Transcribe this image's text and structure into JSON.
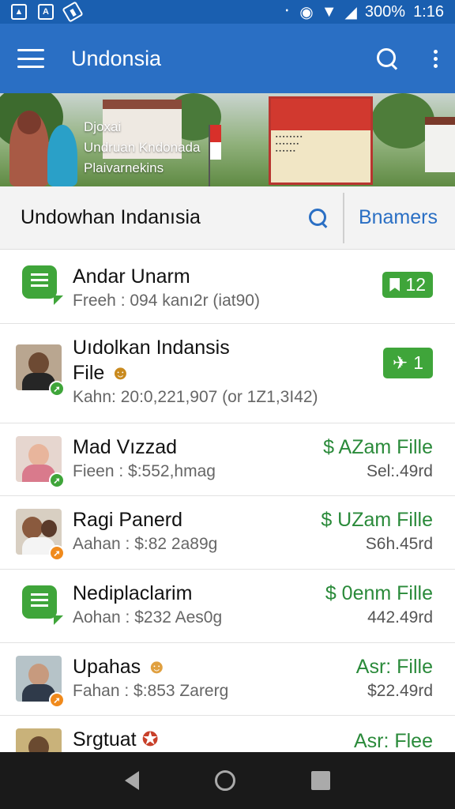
{
  "status_bar": {
    "battery_text": "300%",
    "time": "1:16"
  },
  "app_bar": {
    "title": "Undonsia"
  },
  "banner": {
    "lines": [
      "Djoxai",
      "Undruan Kndonada",
      "Plaivarnekins"
    ]
  },
  "search_row": {
    "label": "Undowhan Indanısia",
    "button": "Bnamers"
  },
  "rows": [
    {
      "title": "Andar Unarm",
      "subtitle": "Freeh : 094 kanı2r (iat90)",
      "badge": "12",
      "icon": "chat-icon"
    },
    {
      "title_line1": "Uıdolkan Indansis",
      "title_line2": "File",
      "subtitle": "Kahn: 20:0,221,907 (or 1Z1,3I42)",
      "badge": "1",
      "icon": "avatar-man"
    },
    {
      "title": "Mad Vızzad",
      "subtitle": "Fieen : $:552,hmag",
      "right_title": "$ AZam Fille",
      "right_sub": "Sel:.49rd",
      "icon": "avatar-woman"
    },
    {
      "title": "Ragi Panerd",
      "subtitle": "Aahan : $:82 2a89g",
      "right_title": "$ UZam Fille",
      "right_sub": "S6h.45rd",
      "icon": "avatar-couple"
    },
    {
      "title": "Nediplaclarim",
      "subtitle": "Aohan : $232 Aes0g",
      "right_title": "$ 0enm Fille",
      "right_sub": "442.49rd",
      "icon": "chat-icon"
    },
    {
      "title": "Upahas",
      "subtitle": "Fahan : $:853 Zarerg",
      "right_title": "Asr: Fille",
      "right_sub": "$22.49rd",
      "icon": "avatar-elder"
    },
    {
      "title": "Srgtuat",
      "subtitle": "",
      "right_title": "Asr: Flee",
      "right_sub": "",
      "icon": "avatar-partial"
    }
  ],
  "colors": {
    "status_bar": "#1a5fb0",
    "app_bar": "#2a6fc4",
    "accent_green": "#3fa53a",
    "price_green": "#2a8a3a"
  }
}
